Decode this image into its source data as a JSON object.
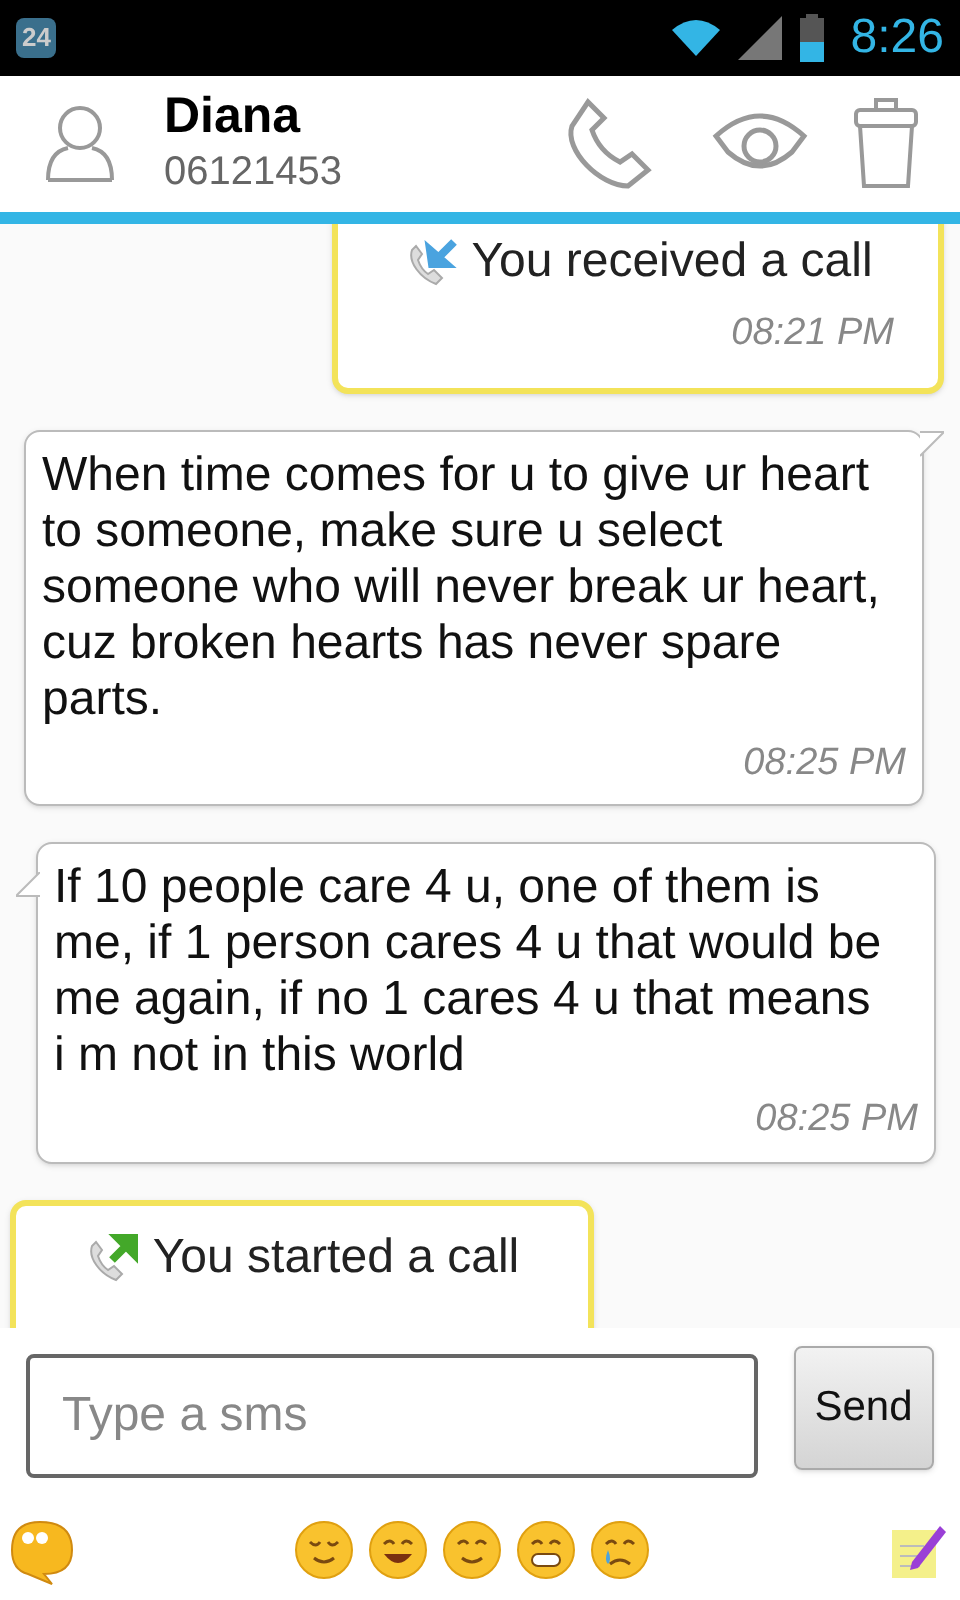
{
  "status_bar": {
    "notification_badge": "24",
    "time": "8:26"
  },
  "contact": {
    "name": "Diana",
    "number": "06121453"
  },
  "messages": [
    {
      "kind": "incoming_call",
      "text": "You received a call",
      "time": "08:21 PM"
    },
    {
      "kind": "sms",
      "tail_on_right": true,
      "text": "When time comes for u to give ur heart to someone, make sure u select someone who will never break ur heart, cuz broken hearts has never spare parts.",
      "time": "08:25 PM"
    },
    {
      "kind": "sms",
      "tail_on_right": false,
      "text": "If 10 people care 4 u, one of them is me, if 1 person cares 4 u that would be me again, if no 1 cares 4 u that means i m not in this world",
      "time": "08:25 PM"
    },
    {
      "kind": "outgoing_call",
      "text": "You started a call"
    }
  ],
  "compose": {
    "placeholder": "Type a sms",
    "send_label": "Send"
  }
}
